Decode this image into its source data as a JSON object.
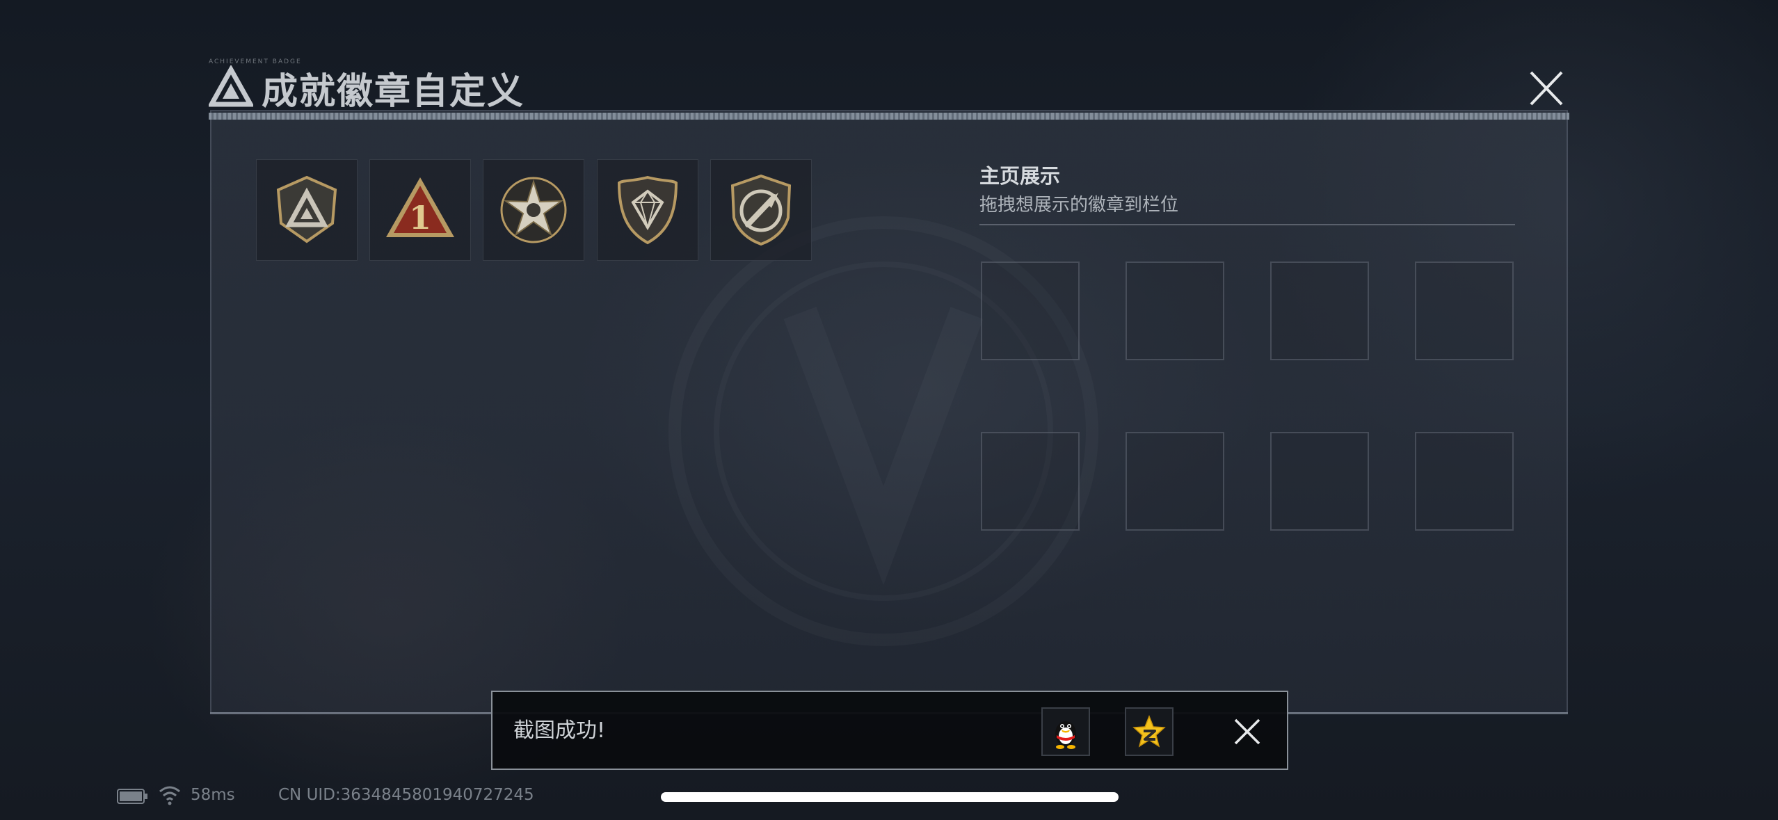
{
  "header": {
    "title": "成就徽章自定义",
    "tiny_caption": "ACHIEVEMENT BADGE",
    "close_icon": "close-icon"
  },
  "badges": [
    {
      "name": "delta-triangle-shield-badge",
      "icon": "delta-shield-icon"
    },
    {
      "name": "rank-one-triangle-badge",
      "icon": "number-one-triangle-icon"
    },
    {
      "name": "star-skull-badge",
      "icon": "star-emblem-icon"
    },
    {
      "name": "diamond-shield-badge",
      "icon": "diamond-shield-icon"
    },
    {
      "name": "knife-shield-badge",
      "icon": "knife-shield-icon"
    }
  ],
  "showcase": {
    "title": "主页展示",
    "subtitle": "拖拽想展示的徽章到栏位",
    "slot_count": 8
  },
  "toast": {
    "message": "截图成功!",
    "share_qq_icon": "qq-penguin-icon",
    "share_qzone_icon": "qzone-star-icon",
    "close_icon": "close-icon"
  },
  "status_bar": {
    "battery_icon": "battery-icon",
    "wifi_icon": "wifi-icon",
    "latency": "58ms",
    "uid": "CN UID:3634845801940727245"
  },
  "colors": {
    "badge_gold": "#b79a63",
    "badge_red": "#8a2b1f",
    "qzone_yellow": "#f4c21c"
  }
}
